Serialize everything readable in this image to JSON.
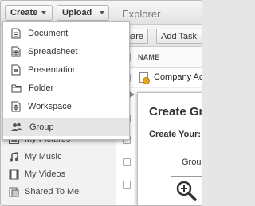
{
  "toolbar": {
    "create_label": "Create",
    "upload_label": "Upload",
    "explorer_title": "Explorer"
  },
  "create_menu": {
    "items": [
      {
        "label": "Document",
        "icon": "document-icon"
      },
      {
        "label": "Spreadsheet",
        "icon": "spreadsheet-icon"
      },
      {
        "label": "Presentation",
        "icon": "presentation-icon"
      },
      {
        "label": "Folder",
        "icon": "folder-icon"
      },
      {
        "label": "Workspace",
        "icon": "workspace-icon"
      },
      {
        "label": "Group",
        "icon": "group-icon",
        "selected": true
      }
    ]
  },
  "sidebar": {
    "items": [
      {
        "label": "My Pictures",
        "icon": "picture-icon"
      },
      {
        "label": "My Music",
        "icon": "music-icon"
      },
      {
        "label": "My Videos",
        "icon": "video-icon"
      },
      {
        "label": "Shared To Me",
        "icon": "shared-icon"
      }
    ]
  },
  "explorer": {
    "share_label": "Share",
    "add_task_label": "Add Task",
    "column_name": "NAME",
    "rows": [
      {
        "name": "Company Ac"
      }
    ]
  },
  "modal": {
    "title": "Create Gro",
    "create_your": "Create Your:",
    "group_label": "Group"
  }
}
